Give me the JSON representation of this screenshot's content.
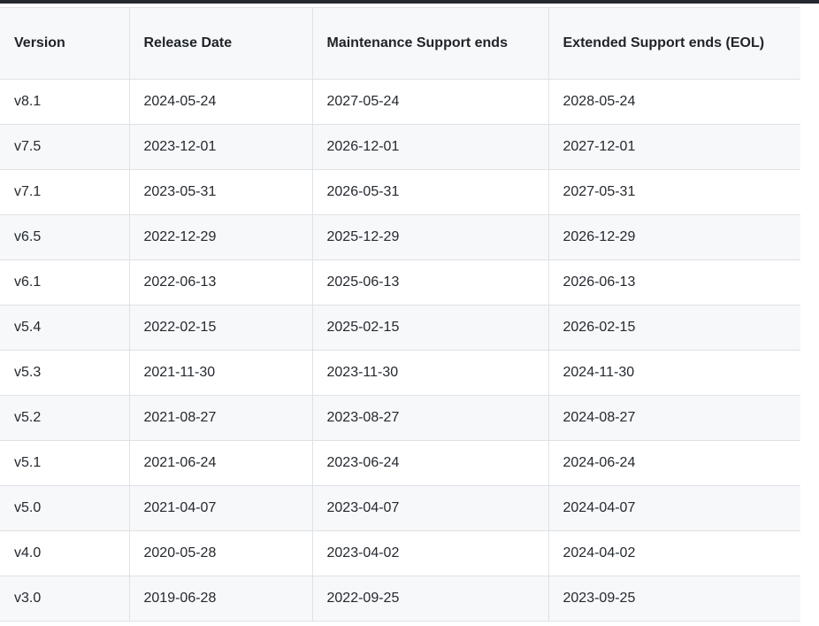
{
  "table": {
    "headers": [
      "Version",
      "Release Date",
      "Maintenance Support ends",
      "Extended Support ends (EOL)"
    ],
    "rows": [
      [
        "v8.1",
        "2024-05-24",
        "2027-05-24",
        "2028-05-24"
      ],
      [
        "v7.5",
        "2023-12-01",
        "2026-12-01",
        "2027-12-01"
      ],
      [
        "v7.1",
        "2023-05-31",
        "2026-05-31",
        "2027-05-31"
      ],
      [
        "v6.5",
        "2022-12-29",
        "2025-12-29",
        "2026-12-29"
      ],
      [
        "v6.1",
        "2022-06-13",
        "2025-06-13",
        "2026-06-13"
      ],
      [
        "v5.4",
        "2022-02-15",
        "2025-02-15",
        "2026-02-15"
      ],
      [
        "v5.3",
        "2021-11-30",
        "2023-11-30",
        "2024-11-30"
      ],
      [
        "v5.2",
        "2021-08-27",
        "2023-08-27",
        "2024-08-27"
      ],
      [
        "v5.1",
        "2021-06-24",
        "2023-06-24",
        "2024-06-24"
      ],
      [
        "v5.0",
        "2021-04-07",
        "2023-04-07",
        "2024-04-07"
      ],
      [
        "v4.0",
        "2020-05-28",
        "2023-04-02",
        "2024-04-02"
      ],
      [
        "v3.0",
        "2019-06-28",
        "2022-09-25",
        "2023-09-25"
      ]
    ]
  },
  "colors": {
    "header_bg": "#f6f8fa",
    "stripe_bg": "#f6f8fa",
    "border": "#dfe2e5",
    "text": "#24292f",
    "topbar": "#24292f"
  }
}
